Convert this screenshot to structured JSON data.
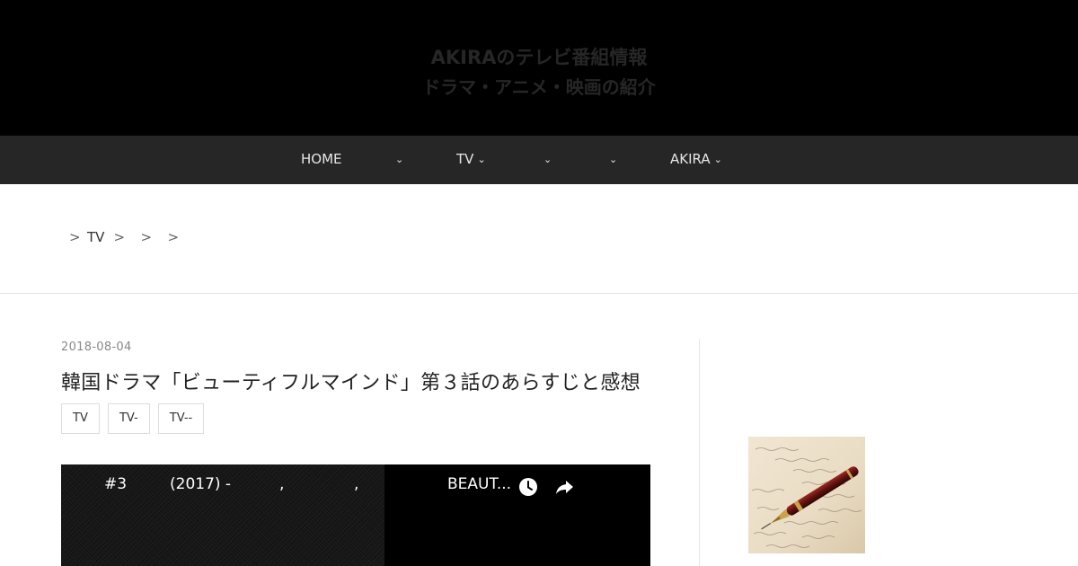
{
  "header": {
    "title_line1": "AKIRAのテレビ番組情報",
    "title_line2": "ドラマ・アニメ・映画の紹介"
  },
  "nav": {
    "items": [
      {
        "label": "HOME",
        "has_chevron": false
      },
      {
        "label": "",
        "has_chevron": true
      },
      {
        "label": "TV",
        "has_chevron": true
      },
      {
        "label": "",
        "has_chevron": true
      },
      {
        "label": "",
        "has_chevron": true
      },
      {
        "label": "AKIRA",
        "has_chevron": true
      }
    ]
  },
  "breadcrumb": {
    "separator": ">",
    "items": [
      "TV",
      "",
      "",
      ""
    ]
  },
  "entry": {
    "date": "2018-08-04",
    "title": "韓国ドラマ「ビューティフルマインド」第３話のあらすじと感想",
    "categories": [
      "TV",
      "TV-",
      "TV--"
    ]
  },
  "video": {
    "episode": "#3",
    "year": "(2017) -",
    "comma1": ",",
    "comma2": ",",
    "title_truncated": "BEAUT...",
    "watch_later_icon": "clock-icon",
    "share_icon": "share-icon"
  },
  "sidebar": {
    "image_icon": "fountain-pen-image"
  },
  "colors": {
    "header_bg": "#000000",
    "nav_bg": "#262626",
    "nav_text": "#e6e6e6",
    "site_title": "#262626"
  }
}
